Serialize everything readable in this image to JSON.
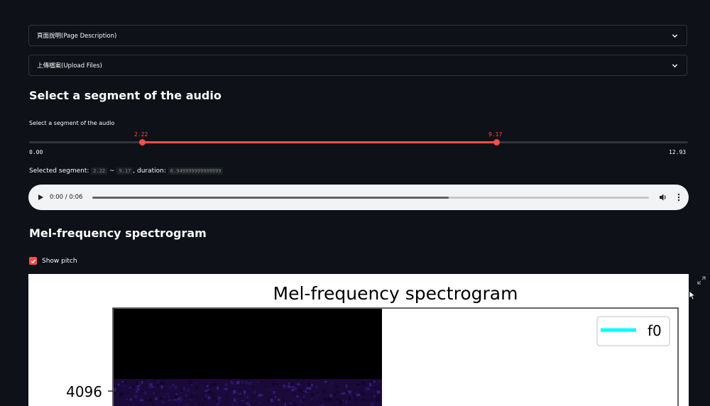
{
  "expanders": [
    {
      "label": "頁面說明(Page Description)"
    },
    {
      "label": "上傳檔案(Upload Files)"
    }
  ],
  "segment_section": {
    "title": "Select a segment of the audio",
    "slider_label": "Select a segment of the audio",
    "min": "0.00",
    "max": "12.93",
    "low": "2.22",
    "high": "9.17",
    "low_value": 2.22,
    "high_value": 9.17,
    "range_max": 12.93,
    "selected_text": "Selected segment:",
    "sep": "~",
    "duration_text": ", duration:",
    "duration_value": "6.949999999999999"
  },
  "audio": {
    "time": "0:00 / 0:06",
    "progress": 0.64
  },
  "spectrogram_section": {
    "title": "Mel-frequency spectrogram",
    "checkbox_label": "Show pitch",
    "checkbox_checked": true
  },
  "chart_data": {
    "type": "heatmap",
    "title": "Mel-frequency spectrogram",
    "legend": [
      {
        "name": "f0",
        "color": "#00ffff"
      }
    ],
    "legend_position": "top-right",
    "y_tick_labels": [
      "4096"
    ]
  },
  "colors": {
    "accent": "#ff4b4b",
    "background": "#0e1117",
    "border": "#31333f"
  }
}
